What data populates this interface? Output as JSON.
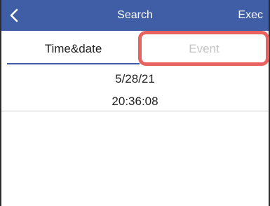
{
  "header": {
    "title": "Search",
    "exec_label": "Exec",
    "back_icon": "chevron-left-icon",
    "background_color": "#3f5ea6"
  },
  "tabs": [
    {
      "label": "Time&date",
      "selected": true
    },
    {
      "label": "Event",
      "selected": false
    }
  ],
  "record": {
    "date": "5/28/21",
    "time": "20:36:08"
  },
  "highlight_color": "#e8625f"
}
